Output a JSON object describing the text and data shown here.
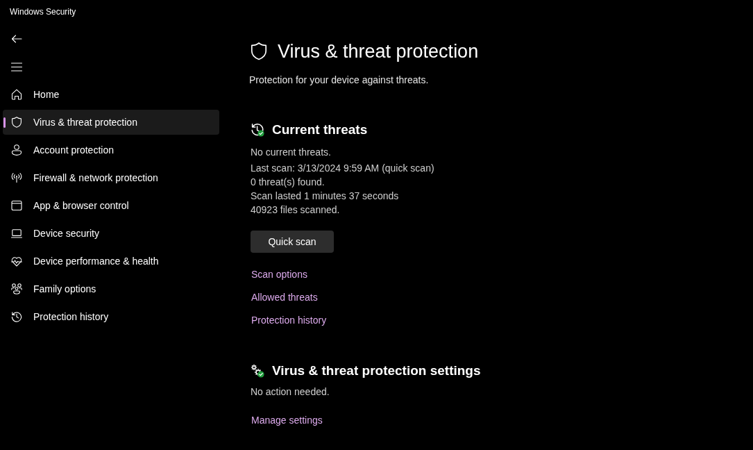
{
  "window": {
    "title": "Windows Security"
  },
  "sidebar": {
    "items": [
      {
        "label": "Home",
        "selected": false
      },
      {
        "label": "Virus & threat protection",
        "selected": true
      },
      {
        "label": "Account protection",
        "selected": false
      },
      {
        "label": "Firewall & network protection",
        "selected": false
      },
      {
        "label": "App & browser control",
        "selected": false
      },
      {
        "label": "Device security",
        "selected": false
      },
      {
        "label": "Device performance & health",
        "selected": false
      },
      {
        "label": "Family options",
        "selected": false
      },
      {
        "label": "Protection history",
        "selected": false
      }
    ]
  },
  "page": {
    "title": "Virus & threat protection",
    "subtitle": "Protection for your device against threats."
  },
  "sections": [
    {
      "title": "Current threats",
      "status": "No current threats.",
      "details": [
        "Last scan: 3/13/2024 9:59 AM (quick scan)",
        "0 threat(s) found.",
        "Scan lasted 1 minutes 37 seconds",
        "40923 files scanned."
      ],
      "button": "Quick scan",
      "links": [
        "Scan options",
        "Allowed threats",
        "Protection history"
      ]
    },
    {
      "title": "Virus & threat protection settings",
      "status": "No action needed.",
      "links": [
        "Manage settings"
      ]
    }
  ]
}
